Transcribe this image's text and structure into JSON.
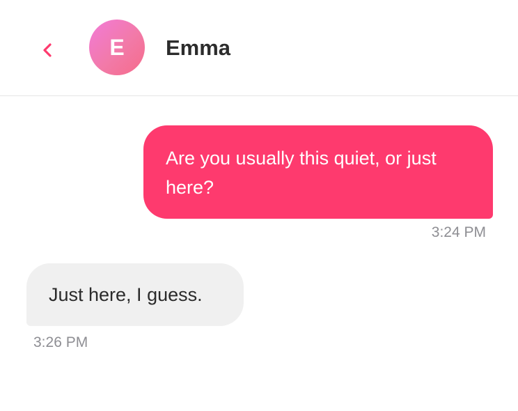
{
  "header": {
    "avatar_initial": "E",
    "name": "Emma"
  },
  "icons": {
    "back": "chevron-left-icon"
  },
  "colors": {
    "accent": "#fe3a6e",
    "incoming_bubble": "#f0f0f0",
    "timestamp": "#8e8e93"
  },
  "messages": [
    {
      "direction": "outgoing",
      "text": "Are you usually this quiet, or just here?",
      "time": "3:24 PM"
    },
    {
      "direction": "incoming",
      "text": "Just here, I guess.",
      "time": "3:26 PM"
    }
  ]
}
